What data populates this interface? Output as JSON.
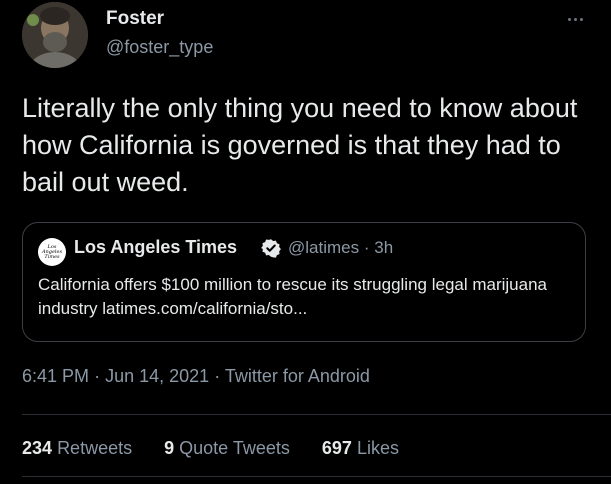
{
  "tweet": {
    "author": {
      "display_name": "Foster",
      "handle": "@foster_type"
    },
    "text": "Literally the only thing you need to know about how California is governed is that they had to bail out weed.",
    "quoted": {
      "logo_text": "Los Angeles Times",
      "display_name": "Los Angeles Times",
      "handle": "@latimes",
      "separator": "·",
      "age": "3h",
      "text": "California offers $100 million to rescue its struggling legal marijuana industry latimes.com/california/sto..."
    },
    "time": "6:41 PM",
    "date": "Jun 14, 2021",
    "dot": "·",
    "source": "Twitter for Android",
    "stats": {
      "retweets_count": "234",
      "retweets_label": "Retweets",
      "quotes_count": "9",
      "quotes_label": "Quote Tweets",
      "likes_count": "697",
      "likes_label": "Likes"
    }
  },
  "colors": {
    "background": "#000000",
    "primary_text": "#e7e9ea",
    "secondary_text": "#8b98a5",
    "verified_badge": "#e7e9ea",
    "border": "#3b3f44"
  },
  "icons": {
    "more": "more-horizontal-icon",
    "verified": "verified-badge-icon"
  }
}
